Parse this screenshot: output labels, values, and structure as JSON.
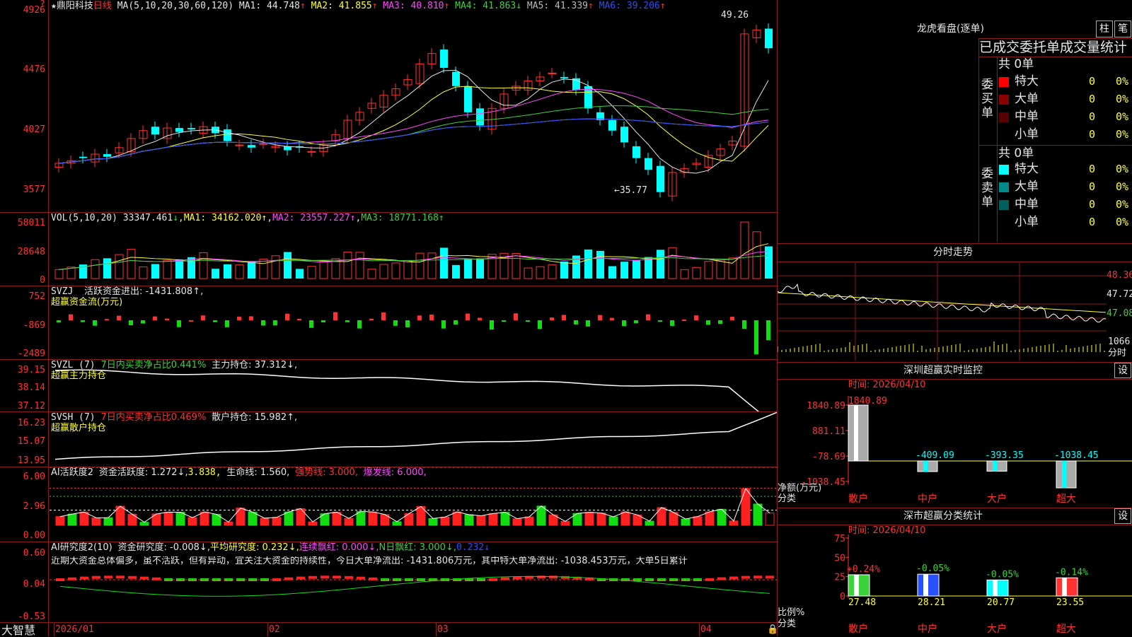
{
  "main_chart": {
    "star": "★",
    "name": "鼎阳科技",
    "period": "日线",
    "ma_label": "MA(5,10,20,30,60,120)",
    "ma": [
      {
        "label": "MA1:",
        "value": "44.748",
        "arrow": "↑",
        "color": "#e6e6e6"
      },
      {
        "label": "MA2:",
        "value": "41.855",
        "arrow": "↑",
        "color": "#ffff3c"
      },
      {
        "label": "MA3:",
        "value": "40.810",
        "arrow": "↑",
        "color": "#ff46ff"
      },
      {
        "label": "MA4:",
        "value": "41.863",
        "arrow": "↓",
        "color": "#3cd23c"
      },
      {
        "label": "MA5:",
        "value": "41.339",
        "arrow": "↑",
        "color": "#bbbbbb"
      },
      {
        "label": "MA6:",
        "value": "39.206",
        "arrow": "↑",
        "color": "#2850ff"
      }
    ],
    "y_ticks": [
      "4926",
      "4476",
      "4027",
      "3577"
    ],
    "high_label": "49.26",
    "low_label": "35.77",
    "low_arrow": "←"
  },
  "vol": {
    "label": "VOL(5,10,20)",
    "value": "33347.461",
    "arrow": "↓",
    "ma1": "MA1: 34162.020↑",
    "ma2": "MA2: 23557.227↑",
    "ma3": "MA3: 18771.168↑",
    "y_ticks": [
      "58011",
      "28648",
      "0"
    ]
  },
  "svzj": {
    "label": "SVZJ",
    "text": "活跃资金进出: -1431.808↑,",
    "sub": "超赢资金流(万元)",
    "y_ticks": [
      "752",
      "-869",
      "-2489"
    ]
  },
  "svzl": {
    "label": "SVZL (7)",
    "text1": "7日内买卖净占比0.441%",
    "text2": "主力持仓: 37.312↓,",
    "sub": "超赢主力持仓",
    "y_ticks": [
      "39.15",
      "38.14",
      "37.12"
    ]
  },
  "svsh": {
    "label": "SVSH (7)",
    "text1": "7日内买卖净占比0.469%",
    "text2": "散户持仓: 15.982↑,",
    "sub": "超赢散户持仓",
    "y_ticks": [
      "16.23",
      "15.07",
      "13.95"
    ]
  },
  "ai_active": {
    "label": "AI活跃度2",
    "t1": "资金活跃度: 1.272↓,",
    "t2": "3.838,",
    "t3": "生命线: 1.560,",
    "t4": "强势线: 3.000,",
    "t5": "爆发线: 6.000,",
    "y_ticks": [
      "6.00",
      "2.96",
      "0.00"
    ]
  },
  "ai_research": {
    "label": "AI研究度2(10)",
    "t1": "资金研究度: -0.008↓,",
    "t2": "平均研究度: 0.232↓,",
    "t3": "连续飘红: 0.000↓,",
    "t4": "N日飘红: 3.000↓,",
    "t5": "0.232↓",
    "commentary": "近期大资金总体偏多，虽不活跃，但有异动，宜关注大资金的持续性，今日大单净流出: -1431.806万元，其中特大单净流出: -1038.453万元，大单5日累计",
    "y_ticks": [
      "0.60",
      "0.04",
      "-0.53"
    ]
  },
  "x_axis": {
    "brand": "大智慧",
    "labels": [
      "2026/01",
      "02",
      "03",
      "04"
    ]
  },
  "dragon_tiger": {
    "title": "龙虎看盘(逐单)",
    "btn_bar": "柱",
    "btn_pen": "笔",
    "header": "已成交委托单成交量统计",
    "buy_side": "委买单",
    "sell_side": "委卖单",
    "buy_total": "共 0单",
    "sell_total": "共 0单",
    "buy_rows": [
      {
        "color": "#ff0000",
        "label": "特大",
        "count": "0",
        "pct": "0%"
      },
      {
        "color": "#8b0000",
        "label": "大单",
        "count": "0",
        "pct": "0%"
      },
      {
        "color": "#5a0000",
        "label": "中单",
        "count": "0",
        "pct": "0%"
      },
      {
        "color": "#000000",
        "label": "小单",
        "count": "0",
        "pct": "0%"
      }
    ],
    "sell_rows": [
      {
        "color": "#00ffff",
        "label": "特大",
        "count": "0",
        "pct": "0%"
      },
      {
        "color": "#008b8b",
        "label": "大单",
        "count": "0",
        "pct": "0%"
      },
      {
        "color": "#006060",
        "label": "中单",
        "count": "0",
        "pct": "0%"
      },
      {
        "color": "#000000",
        "label": "小单",
        "count": "0",
        "pct": "0%"
      }
    ]
  },
  "intraday": {
    "title": "分时走势",
    "y_ticks": [
      "48.36",
      "47.72",
      "47.08"
    ],
    "vol_tick": "1066",
    "vol_unit": "分时"
  },
  "sz_monitor": {
    "title": "深圳超赢实时监控",
    "btn": "设",
    "time": "时间: 2026/04/10",
    "y_ticks": [
      "1840.89",
      "881.11",
      "-78.69",
      "-1038.45"
    ],
    "unit": "净额(万元)",
    "cat_label": "分类",
    "categories": [
      "散户",
      "中户",
      "大户",
      "超大"
    ],
    "values": [
      1840.89,
      -409.09,
      -393.35,
      -1038.45
    ],
    "value_labels": [
      "1840.89",
      "-409.09",
      "-393.35",
      "-1038.45"
    ]
  },
  "sz_class": {
    "title": "深市超赢分类统计",
    "btn": "设",
    "time": "时间: 2026/04/10",
    "y_ticks": [
      "75",
      "50",
      "25",
      "0"
    ],
    "unit": "比例%",
    "cat_label": "分类",
    "categories": [
      "散户",
      "中户",
      "大户",
      "超大"
    ],
    "values": [
      27.48,
      28.21,
      20.77,
      23.55
    ],
    "changes": [
      "+0.24%",
      "-0.05%",
      "-0.05%",
      "-0.14%"
    ],
    "colors": [
      "#3cd23c",
      "#2850ff",
      "#00ffff",
      "#ff3232"
    ]
  }
}
